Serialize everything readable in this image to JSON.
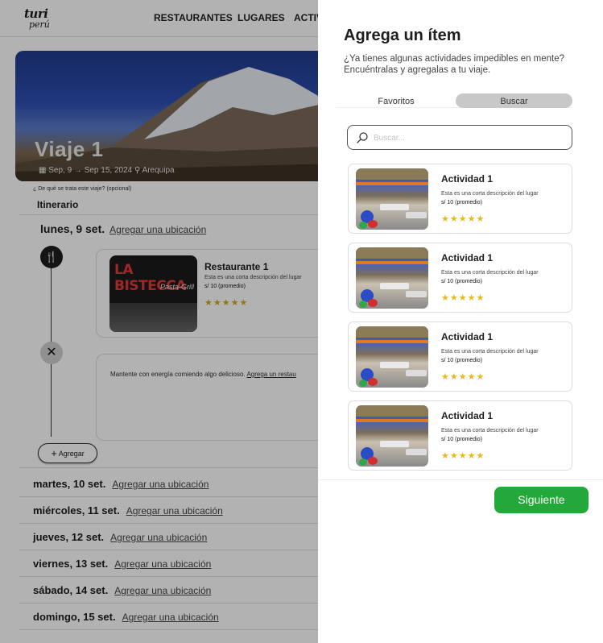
{
  "header": {
    "logo_top": "turi",
    "logo_bottom": "perú",
    "nav": [
      "RESTAURANTES",
      "LUGARES",
      "ACTIV"
    ]
  },
  "trip": {
    "title": "Viaje 1",
    "dates": "Sep, 9 → Sep 15, 2024",
    "location": "Arequipa",
    "description_prompt": "¿ De qué se trata este viaje? (opcional)",
    "itinerary_label": "Itinerario"
  },
  "day1": {
    "label": "lunes, 9 set.",
    "link": "Agregar una ubicación",
    "restaurant": {
      "image_sign": "LA BISTECCA",
      "image_sub": "Pasta-Grill",
      "name": "Restaurante 1",
      "description": "Esta es una corta descripción del lugar",
      "price": "s/ 10 (promedio)",
      "stars": "★★★★★"
    },
    "meal_prompt": "Mantente con energía comiendo algo delicioso.",
    "meal_link": "Agrega un restau",
    "add_button": "Agregar"
  },
  "days": [
    {
      "label": "martes, 10 set.",
      "link": "Agregar una ubicación"
    },
    {
      "label": "miércoles, 11 set.",
      "link": "Agregar una ubicación"
    },
    {
      "label": "jueves, 12 set.",
      "link": "Agregar una ubicación"
    },
    {
      "label": "viernes, 13 set.",
      "link": "Agregar una ubicación"
    },
    {
      "label": "sábado, 14 set.",
      "link": "Agregar una ubicación"
    },
    {
      "label": "domingo, 15 set.",
      "link": "Agregar una ubicación"
    }
  ],
  "modal": {
    "title": "Agrega un ítem",
    "subtitle": "¿Ya tienes algunas actividades impedibles en mente? Encuéntralas y agregalas a tu viaje.",
    "tabs": [
      "Favoritos",
      "Buscar"
    ],
    "active_tab": "Buscar",
    "search": {
      "placeholder": "Buscar..."
    },
    "activities": [
      {
        "name": "Actividad 1",
        "description": "Esta es una corta descripción del lugar",
        "price": "s/ 10 (promedio)",
        "stars": "★★★★★"
      },
      {
        "name": "Actividad 1",
        "description": "Esta es una corta descripción del lugar",
        "price": "s/ 10 (promedio)",
        "stars": "★★★★★"
      },
      {
        "name": "Actividad 1",
        "description": "Esta es una corta descripción del lugar",
        "price": "s/ 10 (promedio)",
        "stars": "★★★★★"
      },
      {
        "name": "Actividad 1",
        "description": "Esta es una corta descripción del lugar",
        "price": "s/ 10 (promedio)",
        "stars": "★★★★★"
      }
    ],
    "next_button": "Siguiente"
  },
  "colors": {
    "accent_green": "#23a83a",
    "star_yellow": "#e8b820",
    "overlay": "rgba(0,0,0,0.30)"
  },
  "icons": [
    "search-icon",
    "calendar-icon",
    "location-pin-icon",
    "utensils-icon",
    "cross-utensils-icon",
    "plus-icon",
    "star-icon"
  ]
}
